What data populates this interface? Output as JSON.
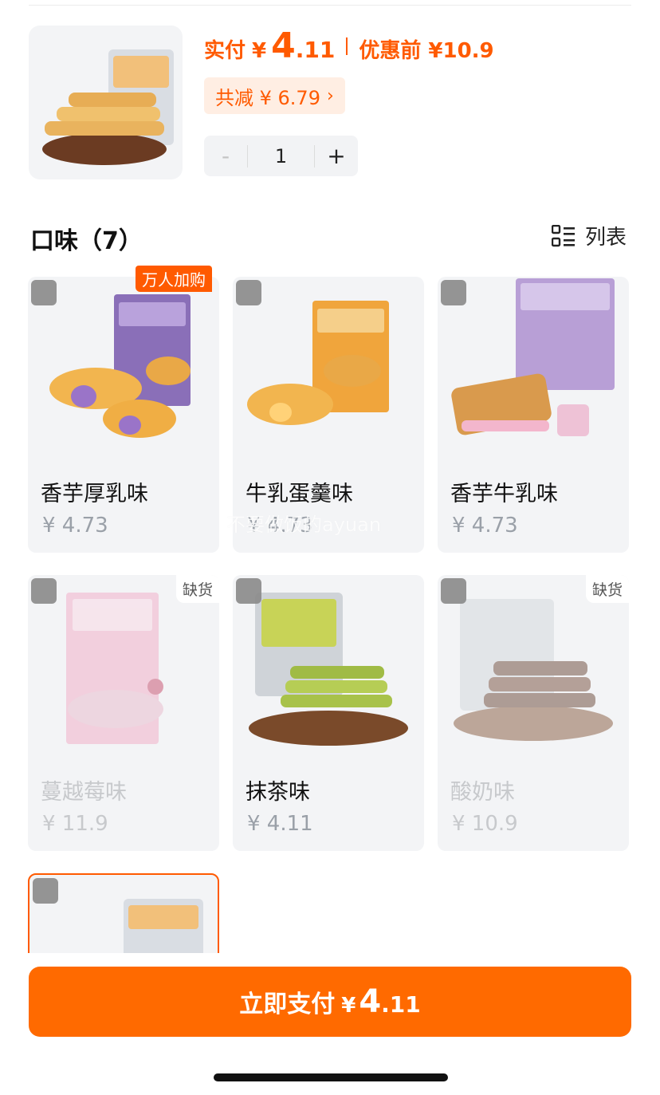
{
  "summary": {
    "paid_label": "实付",
    "currency": "¥",
    "paid_int": "4",
    "paid_dec": ".11",
    "original_label": "优惠前 ¥10.9",
    "discount_label": "共减 ¥ 6.79",
    "discount_chevron": "›",
    "quantity": "1",
    "minus": "-",
    "plus": "+"
  },
  "section": {
    "title": "口味（7）",
    "view_label": "列表"
  },
  "flavors": [
    {
      "name": "香芋厚乳味",
      "price": "¥ 4.73",
      "badge": "万人加购"
    },
    {
      "name": "牛乳蛋羹味",
      "price": "¥ 4.73"
    },
    {
      "name": "香芋牛乳味",
      "price": "¥ 4.73"
    },
    {
      "name": "蔓越莓味",
      "price": "¥ 11.9",
      "badge": "缺货"
    },
    {
      "name": "抹茶味",
      "price": "¥ 4.11"
    },
    {
      "name": "酸奶味",
      "price": "¥ 10.9",
      "badge": "缺货"
    }
  ],
  "watermark": "不要做饭的ayuan",
  "footer": {
    "pay_label": "立即支付",
    "currency": "¥",
    "int": "4",
    "dec": ".11"
  },
  "colors": {
    "accent": "#ff6a00",
    "card_bg": "#f3f4f6"
  }
}
